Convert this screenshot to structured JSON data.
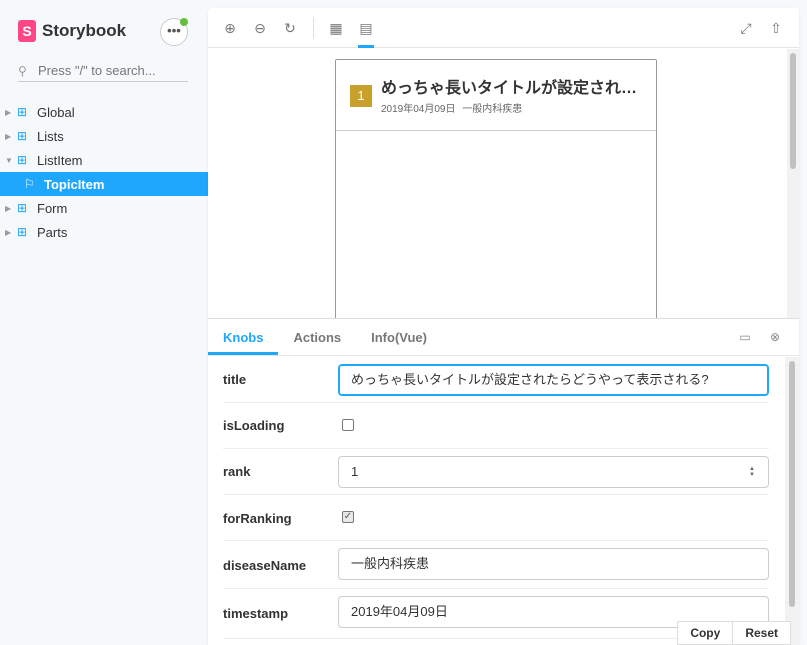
{
  "brand": {
    "logo_letter": "S",
    "name": "Storybook",
    "menu_label": "•••"
  },
  "search": {
    "placeholder": "Press \"/\" to search..."
  },
  "tree": [
    {
      "label": "Global",
      "expanded": false
    },
    {
      "label": "Lists",
      "expanded": false
    },
    {
      "label": "ListItem",
      "expanded": true
    },
    {
      "label": "TopicItem",
      "selected": true
    },
    {
      "label": "Form",
      "expanded": false
    },
    {
      "label": "Parts",
      "expanded": false
    }
  ],
  "preview": {
    "rank": "1",
    "title": "めっちゃ長いタイトルが設定されたらどうやって表示される?",
    "date": "2019年04月09日",
    "disease": "一般内科疾患"
  },
  "tabs": [
    "Knobs",
    "Actions",
    "Info(Vue)"
  ],
  "knobs": {
    "title": {
      "label": "title",
      "value": "めっちゃ長いタイトルが設定されたらどうやって表示される?"
    },
    "isLoading": {
      "label": "isLoading",
      "checked": false
    },
    "rank": {
      "label": "rank",
      "value": "1"
    },
    "forRanking": {
      "label": "forRanking",
      "checked": true
    },
    "diseaseName": {
      "label": "diseaseName",
      "value": "一般内科疾患"
    },
    "timestamp": {
      "label": "timestamp",
      "value": "2019年04月09日"
    }
  },
  "buttons": {
    "copy": "Copy",
    "reset": "Reset"
  },
  "colors": {
    "accent": "#1ea7fd",
    "brand": "#ff4785",
    "rank_badge": "#c8a02a",
    "status_dot": "#66bf3c"
  }
}
